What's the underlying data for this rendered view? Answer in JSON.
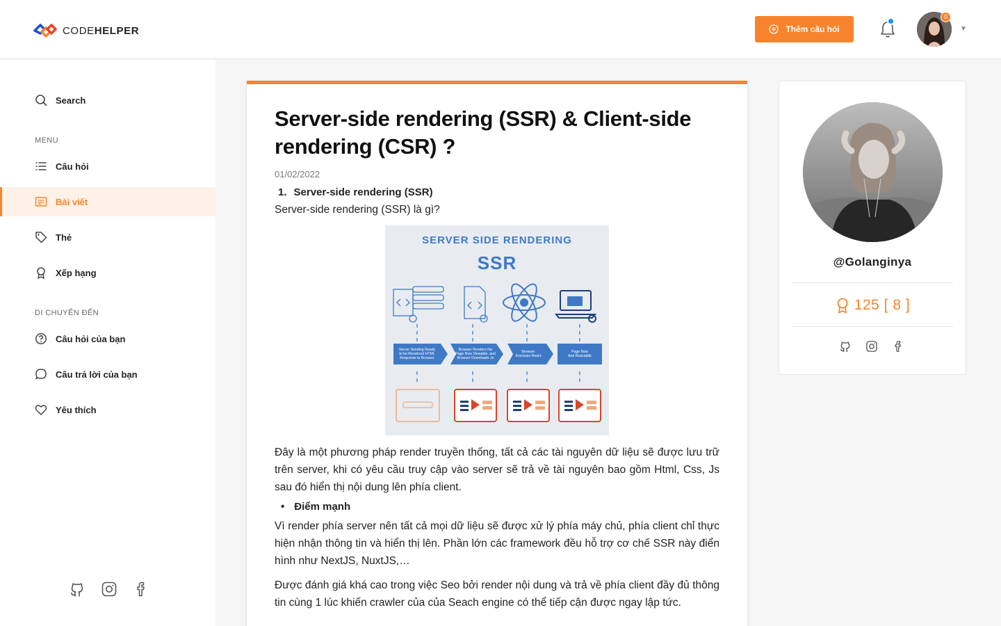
{
  "header": {
    "logo_prefix": "CODE",
    "logo_suffix": "HELPER",
    "ask_button_label": "Thêm câu hỏi",
    "notification_count": "0",
    "accent_color": "#f7842c"
  },
  "sidebar": {
    "search_label": "Search",
    "menu_section": "MENU",
    "menu_items": [
      {
        "label": "Câu hỏi",
        "icon": "list-icon"
      },
      {
        "label": "Bài viết",
        "icon": "article-icon",
        "active": true
      },
      {
        "label": "Thẻ",
        "icon": "tag-icon"
      },
      {
        "label": "Xếp hạng",
        "icon": "award-icon"
      }
    ],
    "nav_section": "DI CHUYỂN ĐẾN",
    "nav_items": [
      {
        "label": "Câu hỏi của bạn",
        "icon": "help-circle-icon"
      },
      {
        "label": "Câu trả lời của bạn",
        "icon": "message-circle-icon"
      },
      {
        "label": "Yêu thích",
        "icon": "heart-icon"
      }
    ],
    "social": [
      "github-icon",
      "instagram-icon",
      "facebook-icon"
    ]
  },
  "article": {
    "title": "Server-side rendering (SSR) & Client-side rendering (CSR) ?",
    "date": "01/02/2022",
    "heading_number": "1.",
    "heading": "Server-side rendering (SSR)",
    "question": "Server-side rendering (SSR) là gì?",
    "image": {
      "title_line1": "SERVER SIDE RENDERING",
      "title_line2": "SSR",
      "steps": [
        "Server Sending Ready to be Rendered HTML Response to Browser",
        "Browser Renders the Page Now Viewable, and Browser Downloads Js",
        "Browser Exectues React",
        "Page Now And Reactable"
      ]
    },
    "paragraph1": "Đây là một phương pháp render truyền thống, tất cả các tài nguyên dữ liệu sẽ được lưu trữ trên server, khi có yêu cầu truy cập vào server sẽ trả về tài nguyên bao gồm Html, Css, Js sau đó hiển thị nội dung lên phía client.",
    "bullet": "Điểm mạnh",
    "paragraph2": "Vì render phía server nên tất cả mọi dữ liệu sẽ được xử lý phía máy chủ, phía client chỉ thực hiện nhận thông tin và hiển thị lên. Phần lớn các framework đều hỗ trợ cơ chế SSR này điển hình như NextJS, NuxtJS,…",
    "paragraph3": "Được đánh giá khá cao trong việc Seo bởi render nội dung và trả về phía client đầy đủ thông tin cùng 1 lúc khiến crawler của của Seach engine có thể tiếp cận được ngay lập tức."
  },
  "profile": {
    "username": "@Golanginya",
    "score": "125 [ 8 ]",
    "social": [
      "github-icon",
      "instagram-icon",
      "facebook-icon"
    ]
  }
}
